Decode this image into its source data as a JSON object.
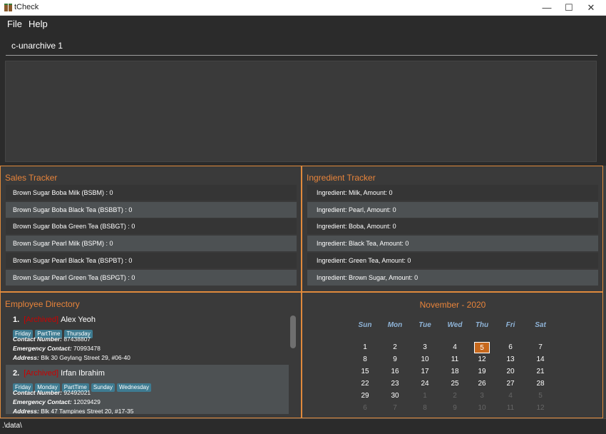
{
  "window": {
    "title": "tCheck",
    "icon": "tea-icon",
    "controls": {
      "minimize": "—",
      "maximize": "☐",
      "close": "✕"
    }
  },
  "menu": {
    "file": "File",
    "help": "Help"
  },
  "command": {
    "value": "c-unarchive 1"
  },
  "result": {
    "text": ""
  },
  "sales": {
    "title": "Sales Tracker",
    "items": [
      "Brown Sugar Boba Milk (BSBM) : 0",
      "Brown Sugar Boba Black Tea (BSBBT) : 0",
      "Brown Sugar Boba Green Tea (BSBGT) : 0",
      "Brown Sugar Pearl Milk (BSPM) : 0",
      "Brown Sugar Pearl Black Tea (BSPBT) : 0",
      "Brown Sugar Pearl Green Tea (BSPGT) : 0"
    ]
  },
  "ingredients": {
    "title": "Ingredient Tracker",
    "items": [
      "Ingredient: Milk,  Amount: 0",
      "Ingredient: Pearl,  Amount: 0",
      "Ingredient: Boba,  Amount: 0",
      "Ingredient: Black Tea,  Amount: 0",
      "Ingredient: Green Tea,  Amount: 0",
      "Ingredient: Brown Sugar,  Amount: 0"
    ]
  },
  "employees": {
    "title": "Employee Directory",
    "labels": {
      "contact": "Contact Number:",
      "emergency": "Emergency Contact:",
      "address": "Address:"
    },
    "list": [
      {
        "index": "1.",
        "archived": "[Archived]",
        "name": "Alex Yeoh",
        "tags": [
          "Friday",
          "PartTime",
          "Thursday"
        ],
        "contact": "87438807",
        "emergency": "70993478",
        "address": "Blk 30 Geylang Street 29, #06-40"
      },
      {
        "index": "2.",
        "archived": "[Archived]",
        "name": "Irfan Ibrahim",
        "tags": [
          "Friday",
          "Monday",
          "PartTime",
          "Sunday",
          "Wednesday"
        ],
        "contact": "92492021",
        "emergency": "12029429",
        "address": "Blk 47 Tampines Street 20, #17-35"
      }
    ]
  },
  "calendar": {
    "title": "November - 2020",
    "dow": [
      "Sun",
      "Mon",
      "Tue",
      "Wed",
      "Thu",
      "Fri",
      "Sat"
    ],
    "weeks": [
      [
        "1",
        "2",
        "3",
        "4",
        "5",
        "6",
        "7"
      ],
      [
        "8",
        "9",
        "10",
        "11",
        "12",
        "13",
        "14"
      ],
      [
        "15",
        "16",
        "17",
        "18",
        "19",
        "20",
        "21"
      ],
      [
        "22",
        "23",
        "24",
        "25",
        "26",
        "27",
        "28"
      ],
      [
        "29",
        "30",
        "1",
        "2",
        "3",
        "4",
        "5"
      ],
      [
        "6",
        "7",
        "8",
        "9",
        "10",
        "11",
        "12"
      ]
    ],
    "today": "5"
  },
  "status": {
    "path": ".\\data\\"
  },
  "colors": {
    "accent": "#e8843a",
    "archived": "#cc0000",
    "tag": "#3e7b91",
    "today": "#c7681c"
  }
}
